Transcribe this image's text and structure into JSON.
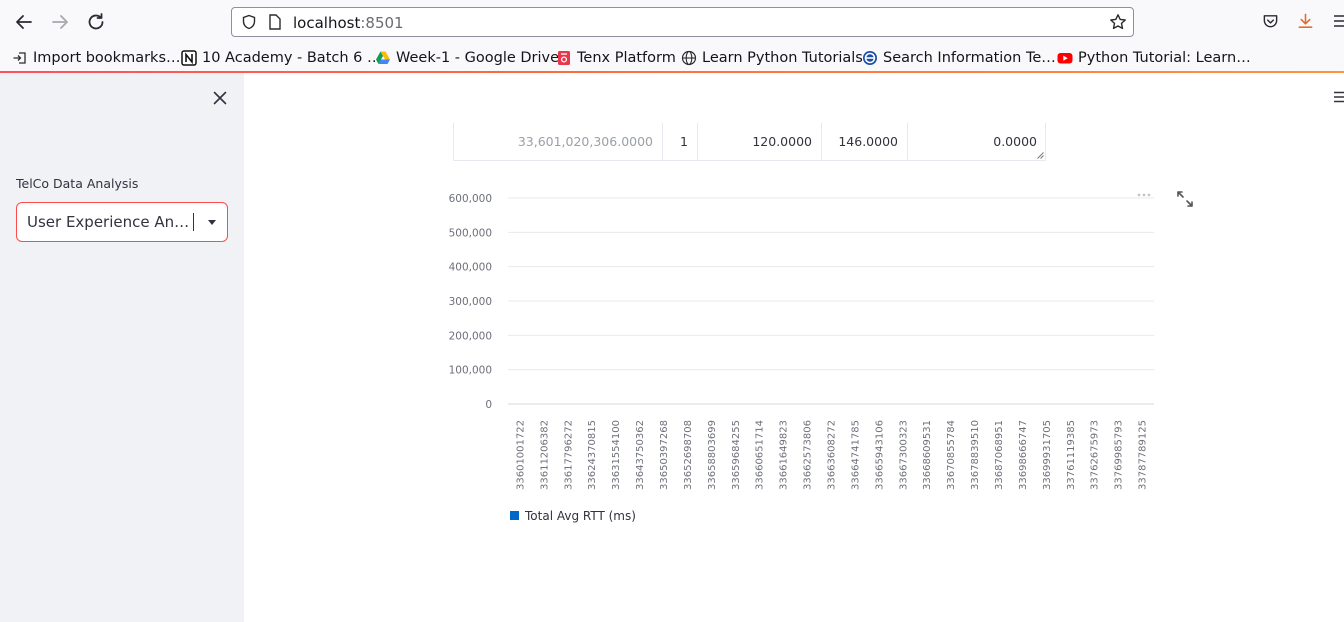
{
  "browser": {
    "url_host": "localhost",
    "url_port": ":8501",
    "bookmarks": [
      {
        "label": "Import bookmarks…",
        "icon": "import-icon"
      },
      {
        "label": "10 Academy - Batch 6 …",
        "icon": "notion-icon"
      },
      {
        "label": "Week-1 - Google Drive",
        "icon": "google-drive-icon"
      },
      {
        "label": "Tenx Platform",
        "icon": "tenx-icon"
      },
      {
        "label": "Learn Python Tutorials",
        "icon": "globe-icon"
      },
      {
        "label": "Search Information Te…",
        "icon": "e-logo-icon"
      },
      {
        "label": "Python Tutorial: Learn…",
        "icon": "youtube-icon"
      }
    ]
  },
  "sidebar": {
    "label": "TelCo Data Analysis",
    "select_value": "User Experience Analysis",
    "accent_color": "#ff4b4b"
  },
  "table": {
    "row": {
      "index": "33,601,020,306.0000",
      "c1": "1",
      "c2": "120.0000",
      "c3": "146.0000",
      "c4": "0.0000"
    }
  },
  "chart_data": {
    "type": "bar",
    "categories": [
      "33601001722",
      "33611206382",
      "33617796272",
      "33624370815",
      "33631554100",
      "33643750362",
      "33650397268",
      "33652698708",
      "33658803699",
      "33659684255",
      "33660651714",
      "33661649823",
      "33662573806",
      "33663608272",
      "33664741785",
      "33665943106",
      "33667300323",
      "33668609531",
      "33670855784",
      "33678839510",
      "33687068951",
      "33698666747",
      "33699931705",
      "33761119385",
      "33762675973",
      "33769985793",
      "33787789125"
    ],
    "series": [
      {
        "name": "Total Avg RTT (ms)",
        "color": "#0068c9",
        "values": []
      }
    ],
    "yticks": [
      "0",
      "100,000",
      "200,000",
      "300,000",
      "400,000",
      "500,000",
      "600,000"
    ],
    "ylim": [
      0,
      600000
    ],
    "grid": true,
    "legend": "bottom-left"
  }
}
